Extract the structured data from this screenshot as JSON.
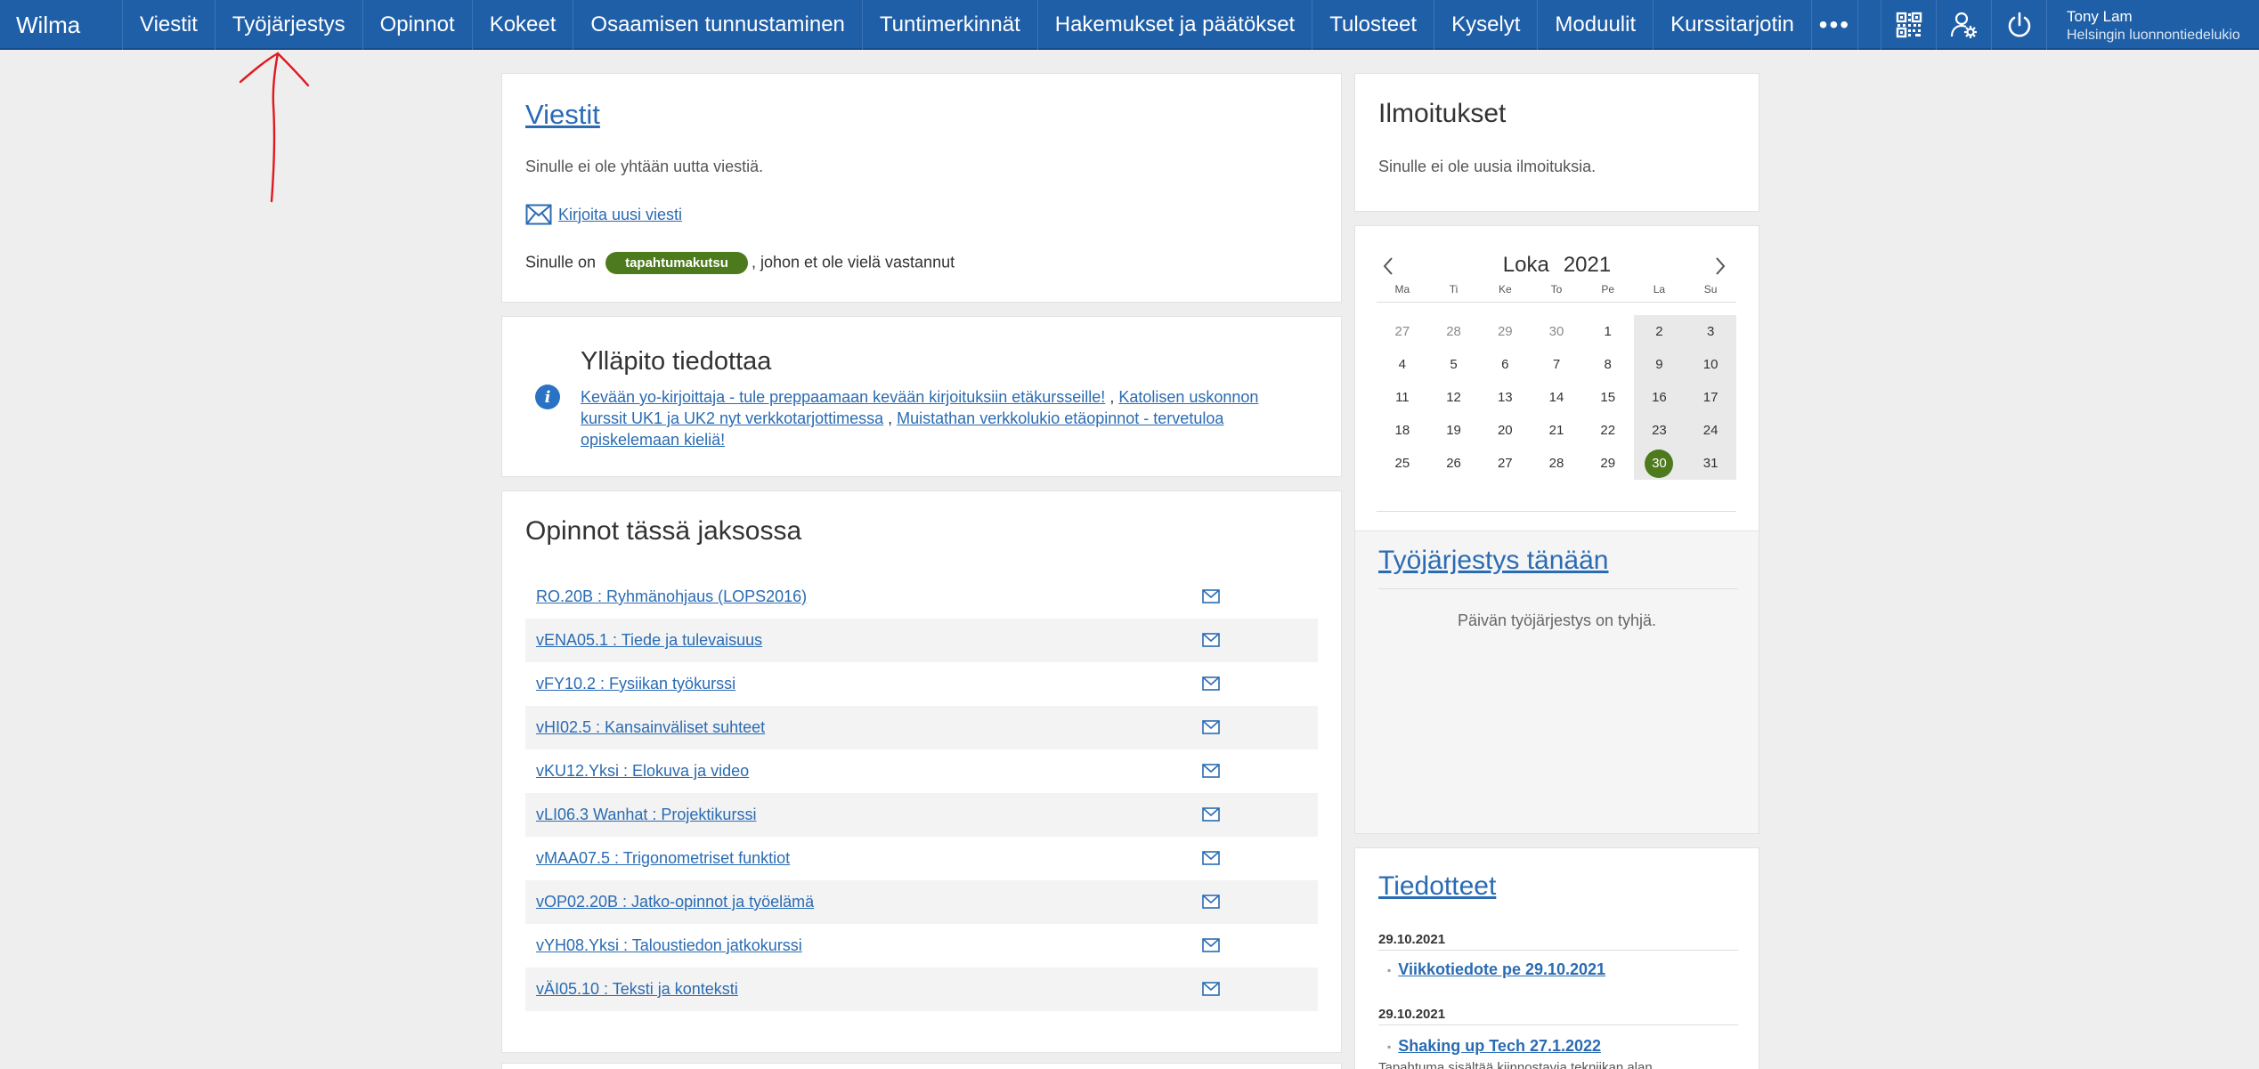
{
  "app": {
    "brand": "Wilma"
  },
  "nav": {
    "items": [
      "Viestit",
      "Työjärjestys",
      "Opinnot",
      "Kokeet",
      "Osaamisen tunnustaminen",
      "Tuntimerkinnät",
      "Hakemukset ja päätökset",
      "Tulosteet",
      "Kyselyt",
      "Moduulit",
      "Kurssitarjotin"
    ],
    "more": "•••"
  },
  "user": {
    "name": "Tony Lam",
    "school": "Helsingin luonnontiedelukio"
  },
  "messages": {
    "title": "Viestit",
    "empty": "Sinulle ei ole yhtään uutta viestiä.",
    "compose": "Kirjoita uusi viesti",
    "invite_pre": "Sinulle on",
    "invite_badge": "tapahtumakutsu",
    "invite_post": ", johon et ole vielä vastannut"
  },
  "admin": {
    "title": "Ylläpito tiedottaa",
    "link1": "Kevään yo-kirjoittaja - tule preppaamaan kevään kirjoituksiin etäkursseille!",
    "sep1": " , ",
    "link2a": "Katolisen uskonnon",
    "link2b": "kurssit UK1 ja UK2 nyt verkkotarjottimessa",
    "sep2": " , ",
    "link3a": "Muistathan verkkolukio etäopinnot - tervetuloa",
    "link3b": "opiskelemaan kieliä!"
  },
  "studies": {
    "title": "Opinnot tässä jaksossa",
    "courses": [
      "RO.20B : Ryhmänohjaus (LOPS2016)",
      "vENA05.1 : Tiede ja tulevaisuus",
      "vFY10.2 : Fysiikan työkurssi",
      "vHI02.5 : Kansainväliset suhteet",
      "vKU12.Yksi : Elokuva ja video",
      "vLI06.3 Wanhat : Projektikurssi",
      "vMAA07.5 : Trigonometriset funktiot",
      "vOP02.20B : Jatko-opinnot ja työelämä",
      "vYH08.Yksi : Taloustiedon jatkokurssi",
      "vÄI05.10 : Teksti ja konteksti"
    ]
  },
  "notices": {
    "title": "Ilmoitukset",
    "empty": "Sinulle ei ole uusia ilmoituksia."
  },
  "calendar": {
    "month": "Loka",
    "year": "2021",
    "weekdays": [
      "Ma",
      "Ti",
      "Ke",
      "To",
      "Pe",
      "La",
      "Su"
    ],
    "days": [
      "27",
      "28",
      "29",
      "30",
      "1",
      "2",
      "3",
      "4",
      "5",
      "6",
      "7",
      "8",
      "9",
      "10",
      "11",
      "12",
      "13",
      "14",
      "15",
      "16",
      "17",
      "18",
      "19",
      "20",
      "21",
      "22",
      "23",
      "24",
      "25",
      "26",
      "27",
      "28",
      "29",
      "30",
      "31"
    ],
    "today": "30"
  },
  "schedule": {
    "title": "Työjärjestys tänään",
    "empty": "Päivän työjärjestys on tyhjä."
  },
  "bulletins": {
    "title": "Tiedotteet",
    "items": [
      {
        "date": "29.10.2021",
        "title": "Viikkotiedote pe 29.10.2021"
      },
      {
        "date": "29.10.2021",
        "title": "Shaking up Tech 27.1.2022",
        "desc": "Tapahtuma sisältää kiinnostavia tekniikan alan"
      }
    ]
  },
  "colors": {
    "nav_bg": "#1f5fa8",
    "accent_green": "#4c7a1c",
    "link": "#2a6bb3",
    "annotation": "#e0191f"
  }
}
